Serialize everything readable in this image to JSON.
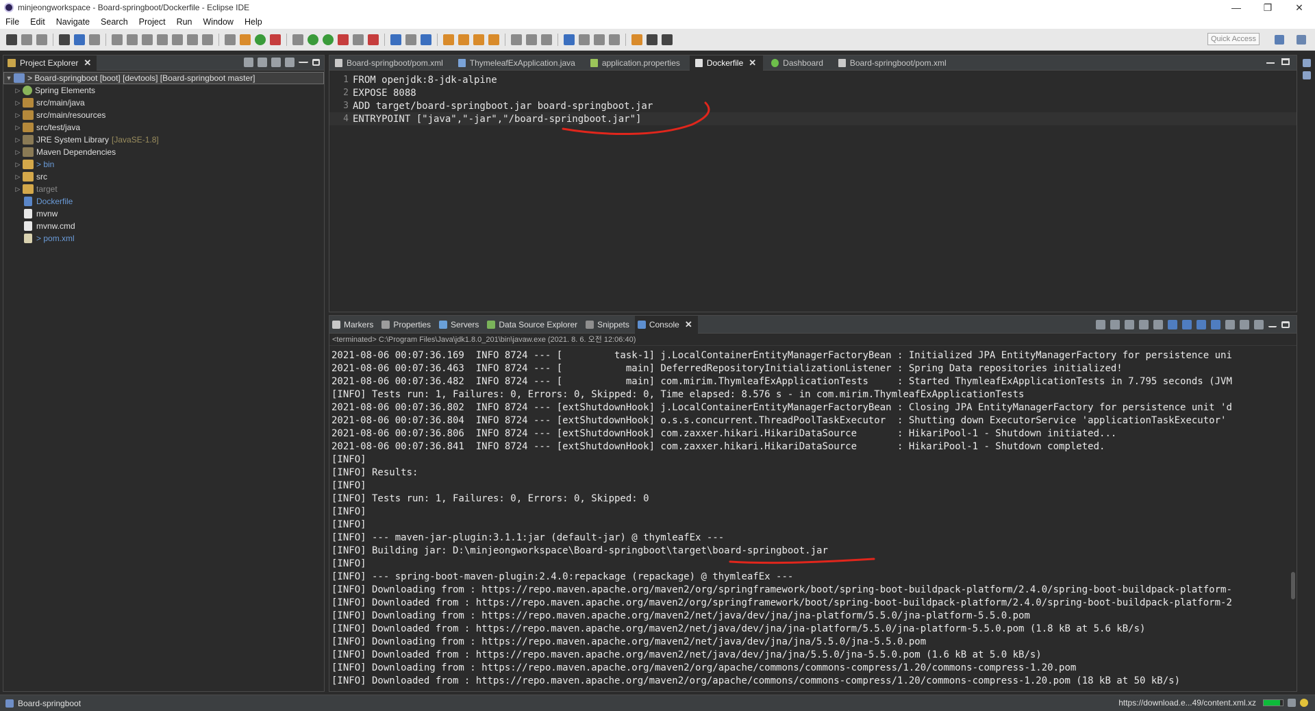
{
  "window": {
    "title": "minjeongworkspace - Board-springboot/Dockerfile - Eclipse IDE",
    "minimize": "—",
    "restore": "❐",
    "close": "✕"
  },
  "menu": [
    "File",
    "Edit",
    "Navigate",
    "Search",
    "Project",
    "Run",
    "Window",
    "Help"
  ],
  "toolbar": {
    "quick_access": "Quick Access"
  },
  "explorer": {
    "tab_label": "Project Explorer",
    "project": "> Board-springboot [boot] [devtools] [Board-springboot master]",
    "items": [
      {
        "label": "Spring Elements",
        "suffix": ""
      },
      {
        "label": "src/main/java",
        "suffix": ""
      },
      {
        "label": "src/main/resources",
        "suffix": ""
      },
      {
        "label": "src/test/java",
        "suffix": ""
      },
      {
        "label": "JRE System Library",
        "suffix": "[JavaSE-1.8]"
      },
      {
        "label": "Maven Dependencies",
        "suffix": ""
      },
      {
        "label": "> bin",
        "suffix": ""
      },
      {
        "label": "src",
        "suffix": ""
      },
      {
        "label": "target",
        "suffix": ""
      },
      {
        "label": "Dockerfile",
        "suffix": ""
      },
      {
        "label": "mvnw",
        "suffix": ""
      },
      {
        "label": "mvnw.cmd",
        "suffix": ""
      },
      {
        "label": "> pom.xml",
        "suffix": ""
      }
    ]
  },
  "editor": {
    "tabs": [
      "Board-springboot/pom.xml",
      "ThymeleafExApplication.java",
      "application.properties",
      "Dockerfile",
      "Dashboard",
      "Board-springboot/pom.xml"
    ],
    "active_tab": "Dockerfile",
    "lines": [
      {
        "n": "1",
        "text": "FROM openjdk:8-jdk-alpine"
      },
      {
        "n": "2",
        "text": "EXPOSE 8088"
      },
      {
        "n": "3",
        "text": "ADD target/board-springboot.jar board-springboot.jar"
      },
      {
        "n": "4",
        "text": "ENTRYPOINT [\"java\",\"-jar\",\"/board-springboot.jar\"]"
      }
    ]
  },
  "console": {
    "tabs": [
      "Markers",
      "Properties",
      "Servers",
      "Data Source Explorer",
      "Snippets",
      "Console"
    ],
    "active_tab": "Console",
    "terminated": "<terminated> C:\\Program Files\\Java\\jdk1.8.0_201\\bin\\javaw.exe (2021. 8. 6. 오전 12:06:40)",
    "lines": [
      "2021-08-06 00:07:36.169  INFO 8724 --- [         task-1] j.LocalContainerEntityManagerFactoryBean : Initialized JPA EntityManagerFactory for persistence uni",
      "2021-08-06 00:07:36.463  INFO 8724 --- [           main] DeferredRepositoryInitializationListener : Spring Data repositories initialized!",
      "2021-08-06 00:07:36.482  INFO 8724 --- [           main] com.mirim.ThymleafExApplicationTests     : Started ThymleafExApplicationTests in 7.795 seconds (JVM",
      "[INFO] Tests run: 1, Failures: 0, Errors: 0, Skipped: 0, Time elapsed: 8.576 s - in com.mirim.ThymleafExApplicationTests",
      "2021-08-06 00:07:36.802  INFO 8724 --- [extShutdownHook] j.LocalContainerEntityManagerFactoryBean : Closing JPA EntityManagerFactory for persistence unit 'd",
      "2021-08-06 00:07:36.804  INFO 8724 --- [extShutdownHook] o.s.s.concurrent.ThreadPoolTaskExecutor  : Shutting down ExecutorService 'applicationTaskExecutor'",
      "2021-08-06 00:07:36.806  INFO 8724 --- [extShutdownHook] com.zaxxer.hikari.HikariDataSource       : HikariPool-1 - Shutdown initiated...",
      "2021-08-06 00:07:36.841  INFO 8724 --- [extShutdownHook] com.zaxxer.hikari.HikariDataSource       : HikariPool-1 - Shutdown completed.",
      "[INFO]",
      "[INFO] Results:",
      "[INFO]",
      "[INFO] Tests run: 1, Failures: 0, Errors: 0, Skipped: 0",
      "[INFO]",
      "[INFO]",
      "[INFO] --- maven-jar-plugin:3.1.1:jar (default-jar) @ thymleafEx ---",
      "[INFO] Building jar: D:\\minjeongworkspace\\Board-springboot\\target\\board-springboot.jar",
      "[INFO]",
      "[INFO] --- spring-boot-maven-plugin:2.4.0:repackage (repackage) @ thymleafEx ---",
      "[INFO] Downloading from : https://repo.maven.apache.org/maven2/org/springframework/boot/spring-boot-buildpack-platform/2.4.0/spring-boot-buildpack-platform-",
      "[INFO] Downloaded from : https://repo.maven.apache.org/maven2/org/springframework/boot/spring-boot-buildpack-platform/2.4.0/spring-boot-buildpack-platform-2",
      "[INFO] Downloading from : https://repo.maven.apache.org/maven2/net/java/dev/jna/jna-platform/5.5.0/jna-platform-5.5.0.pom",
      "[INFO] Downloaded from : https://repo.maven.apache.org/maven2/net/java/dev/jna/jna-platform/5.5.0/jna-platform-5.5.0.pom (1.8 kB at 5.6 kB/s)",
      "[INFO] Downloading from : https://repo.maven.apache.org/maven2/net/java/dev/jna/jna/5.5.0/jna-5.5.0.pom",
      "[INFO] Downloaded from : https://repo.maven.apache.org/maven2/net/java/dev/jna/jna/5.5.0/jna-5.5.0.pom (1.6 kB at 5.0 kB/s)",
      "[INFO] Downloading from : https://repo.maven.apache.org/maven2/org/apache/commons/commons-compress/1.20/commons-compress-1.20.pom",
      "[INFO] Downloaded from : https://repo.maven.apache.org/maven2/org/apache/commons/commons-compress/1.20/commons-compress-1.20.pom (18 kB at 50 kB/s)"
    ]
  },
  "status": {
    "left": "Board-springboot",
    "right": "https://download.e...49/content.xml.xz",
    "progress_fraction": 0.85
  },
  "colors": {
    "annotation": "#e0261c",
    "background": "#2b2b2b",
    "progress": "#0dbb3a"
  }
}
